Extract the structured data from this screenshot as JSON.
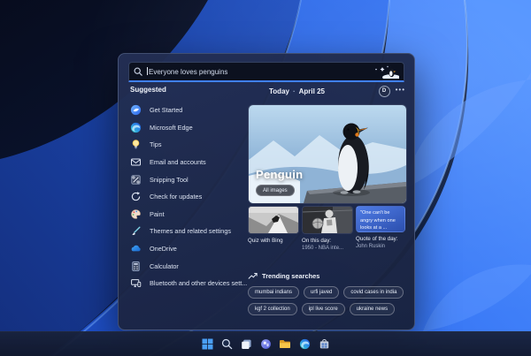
{
  "search": {
    "value": "Everyone loves penguins",
    "icon": "search-icon",
    "decoration": "penguin-snow-sparkles"
  },
  "suggested": {
    "title": "Suggested",
    "items": [
      {
        "label": "Get Started",
        "icon": "get-started-icon"
      },
      {
        "label": "Microsoft Edge",
        "icon": "edge-icon"
      },
      {
        "label": "Tips",
        "icon": "tips-bulb-icon"
      },
      {
        "label": "Email and accounts",
        "icon": "email-icon"
      },
      {
        "label": "Snipping Tool",
        "icon": "snipping-tool-icon"
      },
      {
        "label": "Check for updates",
        "icon": "update-arrows-icon"
      },
      {
        "label": "Paint",
        "icon": "paint-palette-icon"
      },
      {
        "label": "Themes and related settings",
        "icon": "themes-brush-icon"
      },
      {
        "label": "OneDrive",
        "icon": "onedrive-cloud-icon"
      },
      {
        "label": "Calculator",
        "icon": "calculator-icon"
      },
      {
        "label": "Bluetooth and other devices sett...",
        "icon": "devices-icon"
      }
    ]
  },
  "header": {
    "today": "Today",
    "separator": "·",
    "date": "April 25",
    "avatar_initial": "D",
    "more": "•••"
  },
  "hero": {
    "title": "Penguin",
    "badge": "All images"
  },
  "cards": [
    {
      "caption": "Quiz with Bing",
      "subcaption": ""
    },
    {
      "caption": "On this day:",
      "subcaption": "1950 - NBA inte..."
    },
    {
      "quote": "\"One can't be angry when one looks at a ...",
      "caption": "Quote of the day:",
      "subcaption": "John Ruskin"
    }
  ],
  "trending": {
    "title": "Trending searches",
    "icon": "trending-arrow-icon",
    "chips": [
      "mumbai indians",
      "urfi javed",
      "covid cases in india",
      "kgf 2 collection",
      "ipl live score",
      "ukraine news"
    ]
  },
  "taskbar": {
    "icons": [
      "start",
      "search",
      "task-view",
      "widgets",
      "file-explorer",
      "edge",
      "store"
    ]
  },
  "colors": {
    "accent": "#4080ff",
    "panel": "#202b4d",
    "taskbar": "#141c32",
    "quote_card": "#3d6bd8",
    "wallpaper_blue": "#2a63ea"
  }
}
